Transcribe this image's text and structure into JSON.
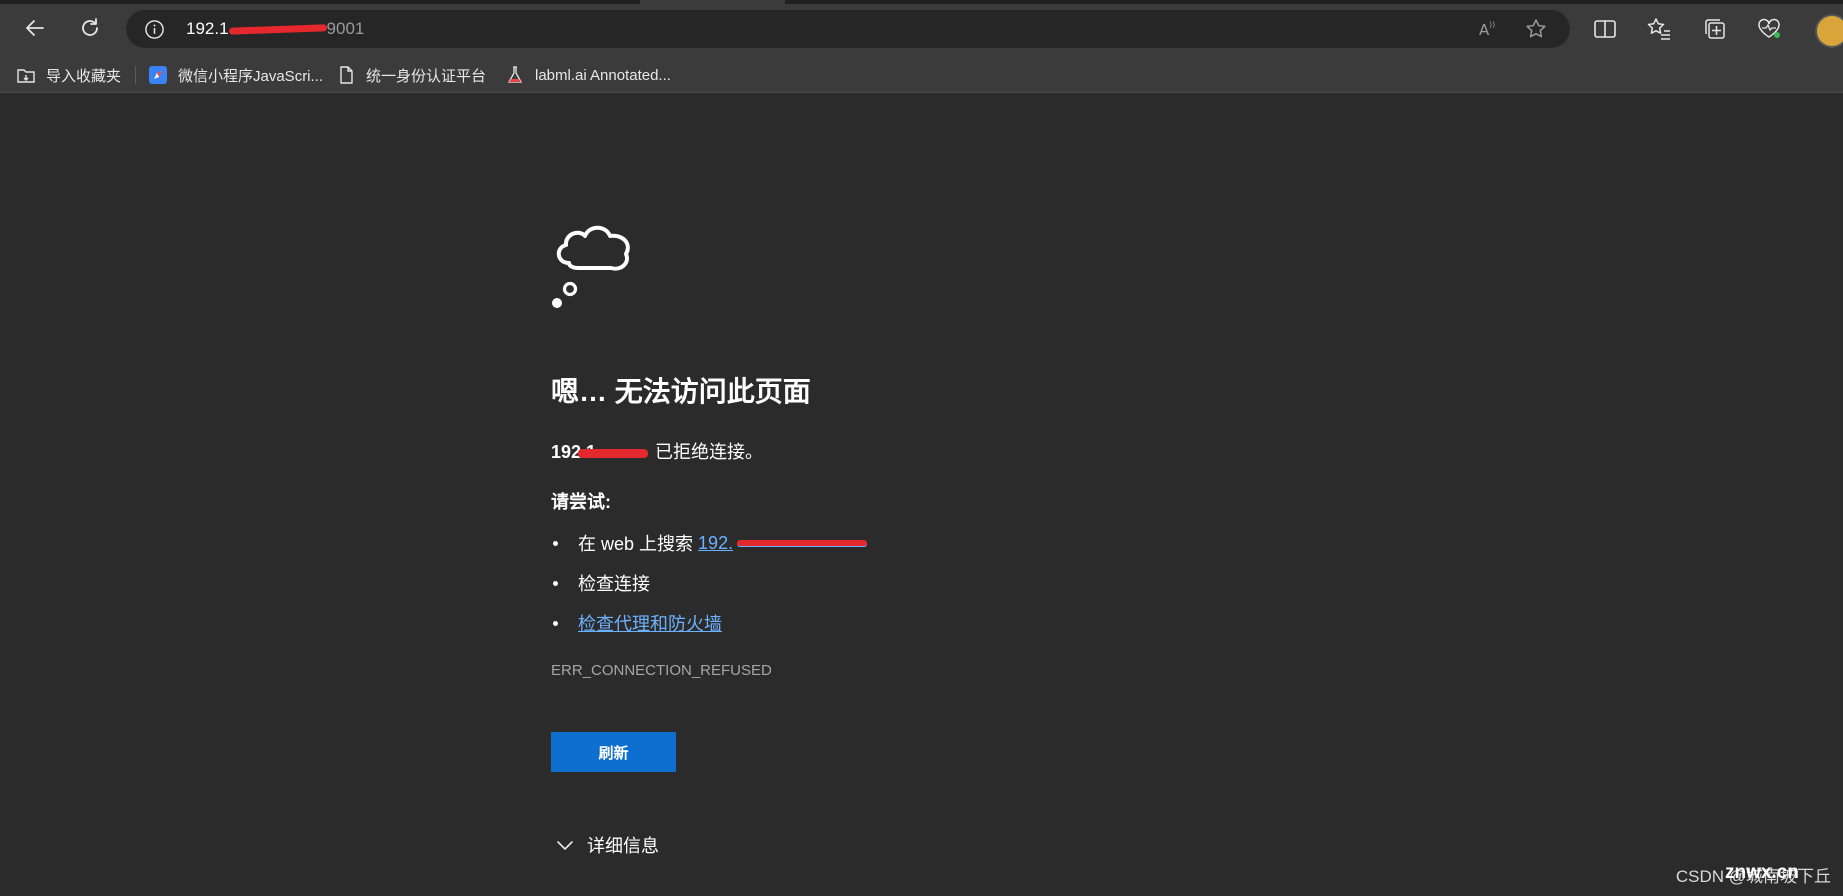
{
  "browser": {
    "address_bar": {
      "url_prefix": "192.1",
      "url_suffix": "9001"
    },
    "bookmarks": [
      {
        "label": "导入收藏夹",
        "icon": "import-favorites-icon"
      },
      {
        "label": "微信小程序JavaScri...",
        "icon": "compass-icon"
      },
      {
        "label": "统一身份认证平台",
        "icon": "document-icon"
      },
      {
        "label": "labml.ai Annotated...",
        "icon": "flask-icon"
      }
    ]
  },
  "error_page": {
    "title": "嗯… 无法访问此页面",
    "host_prefix": "192.1",
    "refused_text": " 已拒绝连接。",
    "try_label": "请尝试:",
    "suggestions": {
      "search_prefix": "在 web 上搜索",
      "search_link": "192.",
      "check_connection": "检查连接",
      "check_proxy": "检查代理和防火墙"
    },
    "error_code": "ERR_CONNECTION_REFUSED",
    "refresh_label": "刷新",
    "details_label": "详细信息",
    "accent_color": "#0f6fd0",
    "link_color": "#6cb1ff"
  },
  "watermark": {
    "csdn": "CSDN @城南坡下丘",
    "znwx": "znwx.cn"
  }
}
